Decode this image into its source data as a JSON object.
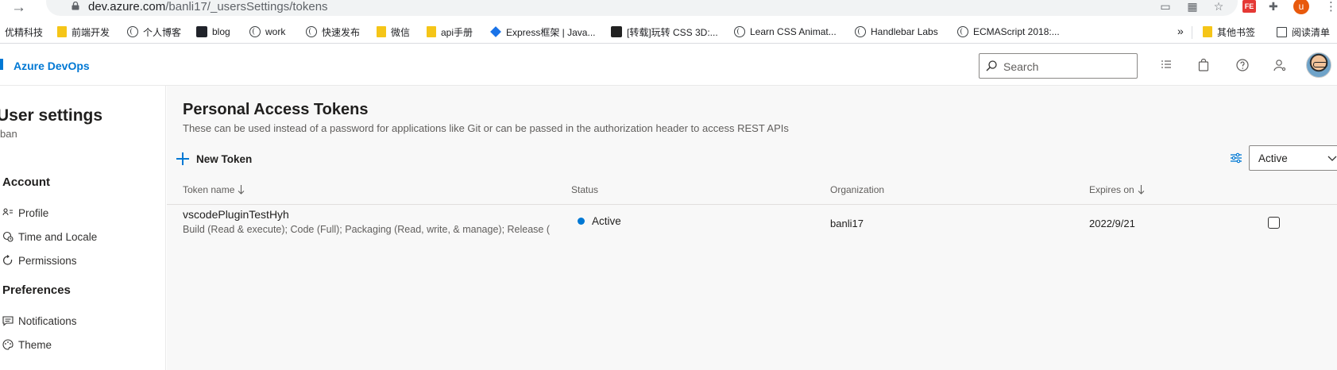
{
  "browser": {
    "url_host": "dev.azure.com",
    "url_path": "/banli17/_usersSettings/tokens",
    "bookmarks": [
      {
        "label": "优精科技",
        "icon": "none"
      },
      {
        "label": "前端开发",
        "icon": "folder-icon"
      },
      {
        "label": "个人博客",
        "icon": "globe-icon"
      },
      {
        "label": "blog",
        "icon": "react-icon"
      },
      {
        "label": "work",
        "icon": "globe-icon"
      },
      {
        "label": "快速发布",
        "icon": "globe-icon"
      },
      {
        "label": "微信",
        "icon": "folder-icon"
      },
      {
        "label": "api手册",
        "icon": "folder-icon"
      },
      {
        "label": "Express框架 | Java...",
        "icon": "layers-icon"
      },
      {
        "label": "[转载]玩转 CSS 3D:...",
        "icon": "site-icon"
      },
      {
        "label": "Learn CSS Animat...",
        "icon": "globe-icon"
      },
      {
        "label": "Handlebar Labs",
        "icon": "globe-icon"
      },
      {
        "label": "ECMAScript 2018:...",
        "icon": "globe-icon"
      }
    ],
    "bookmarks_more": "»",
    "other_bookmarks": "其他书签",
    "reading_list": "阅读清单",
    "profile_initial": "u",
    "ext_badge": "FE"
  },
  "header": {
    "brand": "Azure DevOps",
    "search_placeholder": "Search"
  },
  "sidebar": {
    "title": "User settings",
    "subtitle": "ban",
    "groups": [
      {
        "label": "Account"
      },
      {
        "label": "Preferences"
      }
    ],
    "items": [
      {
        "label": "Profile",
        "icon": "profile-card-icon"
      },
      {
        "label": "Time and Locale",
        "icon": "globe-clock-icon"
      },
      {
        "label": "Permissions",
        "icon": "permissions-icon"
      },
      {
        "label": "Notifications",
        "icon": "chat-bubble-icon"
      },
      {
        "label": "Theme",
        "icon": "palette-icon"
      }
    ]
  },
  "main": {
    "title": "Personal Access Tokens",
    "description": "These can be used instead of a password for applications like Git or can be passed in the authorization header to access REST APIs",
    "new_token_label": "New Token",
    "status_filter_value": "Active",
    "columns": [
      "Token name",
      "Status",
      "Organization",
      "Expires on"
    ],
    "rows": [
      {
        "name": "vscodePluginTestHyh",
        "scopes": "Build (Read & execute); Code (Full); Packaging (Read, write, & manage); Release (Read, write, execute, & manage)",
        "status": "Active",
        "organization": "banli17",
        "expires": "2022/9/21"
      }
    ]
  },
  "colors": {
    "accent": "#0078d4",
    "page_bg": "#f8f8f8",
    "text": "#201f1e"
  }
}
